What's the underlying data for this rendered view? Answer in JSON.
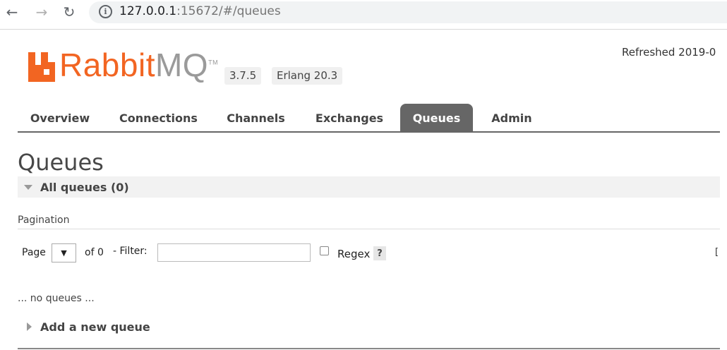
{
  "browser": {
    "url_host": "127.0.0.1",
    "url_rest": ":15672/#/queues"
  },
  "header": {
    "logo_rabbit": "Rabbit",
    "logo_mq": "MQ",
    "logo_tm": "TM",
    "version": "3.7.5",
    "erlang": "Erlang 20.3",
    "refreshed": "Refreshed 2019-0"
  },
  "tabs": [
    {
      "label": "Overview",
      "active": false
    },
    {
      "label": "Connections",
      "active": false
    },
    {
      "label": "Channels",
      "active": false
    },
    {
      "label": "Exchanges",
      "active": false
    },
    {
      "label": "Queues",
      "active": true
    },
    {
      "label": "Admin",
      "active": false
    }
  ],
  "main": {
    "title": "Queues",
    "section_title": "All queues (0)",
    "pagination_label": "Pagination",
    "page_label": "Page",
    "page_select_value": "▼",
    "of_label": "of 0",
    "filter_label": "- Filter:",
    "filter_value": "",
    "regex_label": "Regex",
    "regex_checked": false,
    "help_label": "?",
    "edge_text": "[",
    "empty_text": "... no queues ...",
    "add_queue_label": "Add a new queue"
  },
  "colors": {
    "brand_orange": "#f26522",
    "tab_active_bg": "#666666"
  }
}
